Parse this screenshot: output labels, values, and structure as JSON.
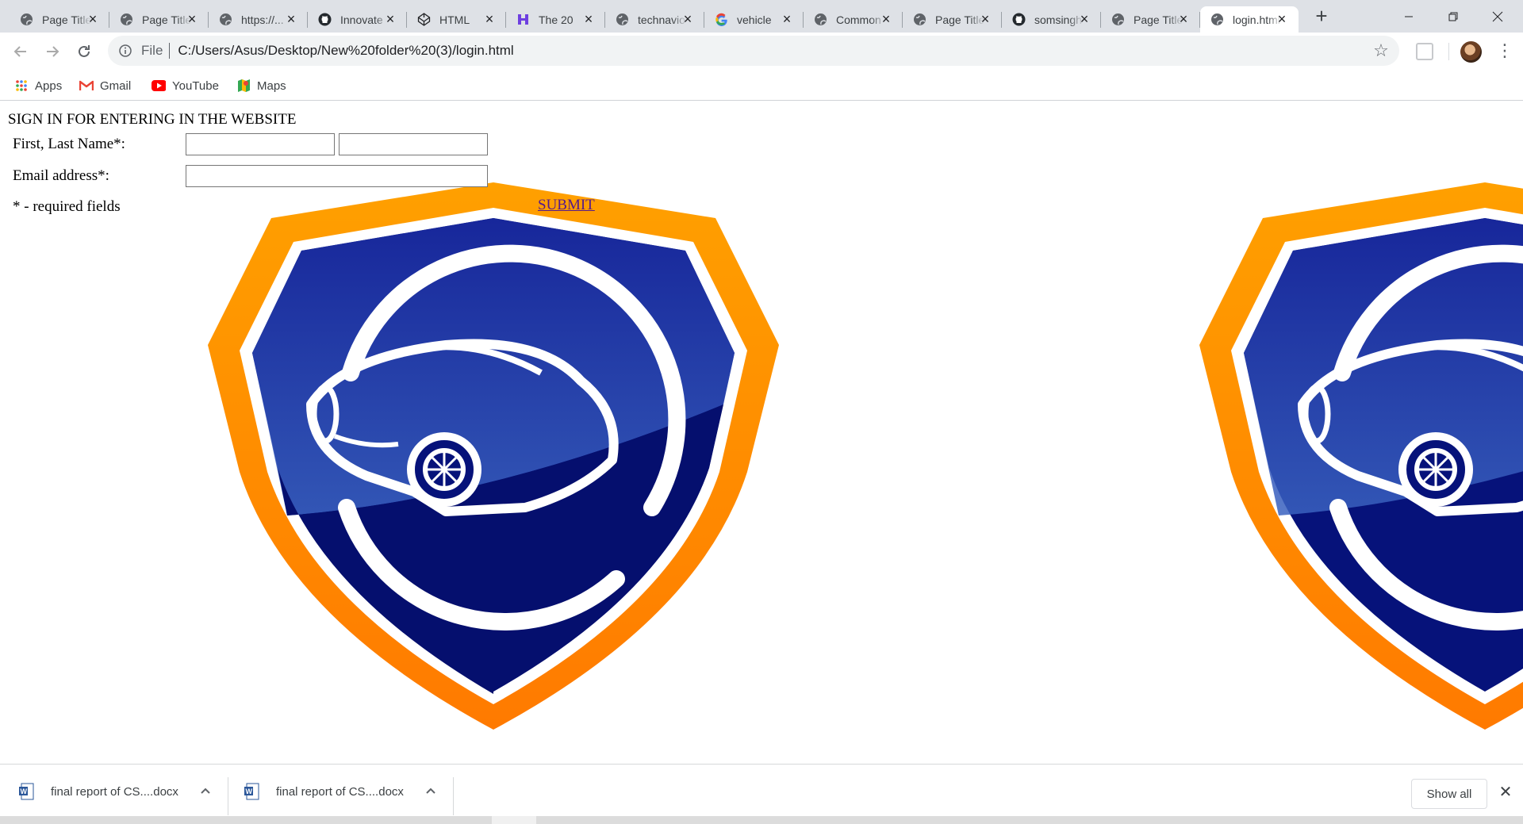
{
  "browser": {
    "tabs": [
      {
        "title": "Page Title",
        "icon": "globe-icon",
        "active": false
      },
      {
        "title": "Page Title",
        "icon": "globe-icon",
        "active": false
      },
      {
        "title": "https://...",
        "icon": "globe-icon",
        "active": false
      },
      {
        "title": "Innovate",
        "icon": "github-icon",
        "active": false
      },
      {
        "title": "HTML",
        "icon": "codepen-icon",
        "active": false
      },
      {
        "title": "The 20",
        "icon": "hack-icon",
        "active": false
      },
      {
        "title": "technavio",
        "icon": "globe-icon",
        "active": false
      },
      {
        "title": "vehicle",
        "icon": "google-icon",
        "active": false
      },
      {
        "title": "Common",
        "icon": "globe-icon",
        "active": false
      },
      {
        "title": "Page Title",
        "icon": "globe-icon",
        "active": false
      },
      {
        "title": "somsingh",
        "icon": "github-icon",
        "active": false
      },
      {
        "title": "Page Title",
        "icon": "globe-icon",
        "active": false
      },
      {
        "title": "login.html",
        "icon": "globe-icon",
        "active": true
      }
    ],
    "new_tab_label": "+",
    "address": {
      "scheme_label": "File",
      "url": "C:/Users/Asus/Desktop/New%20folder%20(3)/login.html"
    },
    "bookmarks": [
      {
        "label": "Apps",
        "icon": "apps-grid-icon"
      },
      {
        "label": "Gmail",
        "icon": "gmail-icon"
      },
      {
        "label": "YouTube",
        "icon": "youtube-icon"
      },
      {
        "label": "Maps",
        "icon": "maps-icon"
      }
    ]
  },
  "page": {
    "heading": "SIGN IN FOR ENTERING IN THE WEBSITE",
    "name_label": "First, Last Name*:",
    "first_name_value": "",
    "last_name_value": "",
    "email_label": "Email address*:",
    "email_value": "",
    "required_note": "* - required fields",
    "submit_label": "SUBMIT",
    "logo": {
      "description_icon": "car-shield-logo",
      "primary_color": "#0c1a8a",
      "border_color": "#ff8c00"
    }
  },
  "downloads": {
    "items": [
      {
        "name": "final report of CS....docx",
        "icon": "word-doc-icon"
      },
      {
        "name": "final report of CS....docx",
        "icon": "word-doc-icon"
      }
    ],
    "show_all_label": "Show all"
  }
}
